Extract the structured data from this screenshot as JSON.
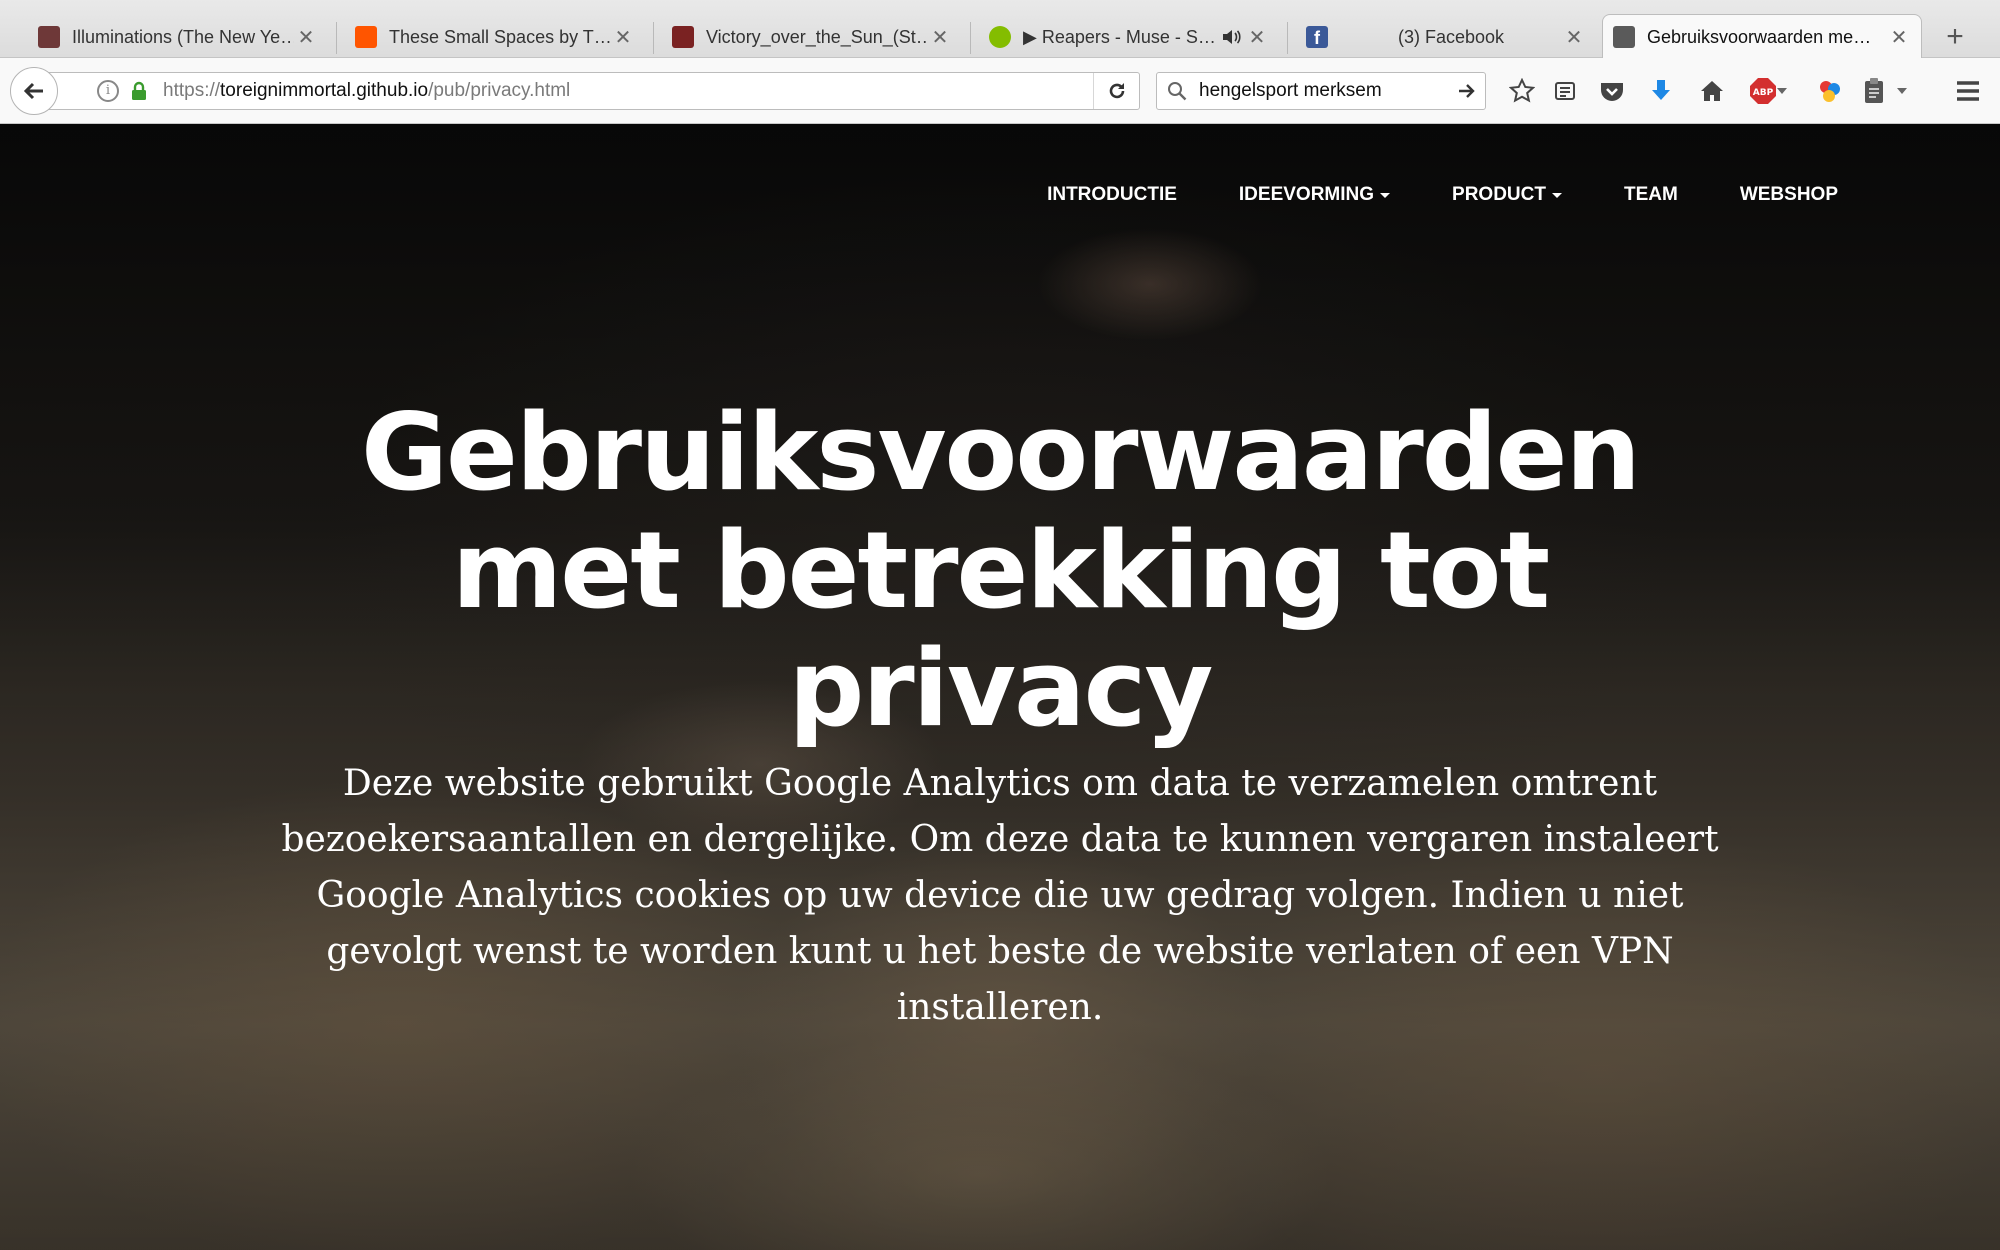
{
  "browser": {
    "tabs": [
      {
        "label": "Illuminations (The New Ye…",
        "favicon_color": "#7a3b3b",
        "active": false
      },
      {
        "label": "These Small Spaces by T…",
        "favicon_color": "#ff5500",
        "active": false
      },
      {
        "label": "Victory_over_the_Sun_(St…",
        "favicon_color": "#8a2a2a",
        "active": false
      },
      {
        "label": "▶ Reapers - Muse - S…",
        "favicon_color": "#84bd00",
        "active": false
      },
      {
        "label": "(3) Facebook",
        "favicon_color": "#3b5998",
        "active": false
      },
      {
        "label": "Gebruiksvoorwaarden me…",
        "favicon_color": "#555555",
        "active": true
      }
    ],
    "new_tab_label": "+",
    "close_glyph": "✕",
    "url": {
      "scheme": "https://",
      "domain": "toreignimmortal.github.io",
      "path": "/pub/privacy.html"
    },
    "search_value": "hengelsport merksem",
    "toolbar_icons": [
      "star-icon",
      "reader-list-icon",
      "pocket-icon",
      "download-icon",
      "home-icon",
      "adblock-plus-icon",
      "color-extension-icon",
      "clipboard-icon",
      "menu-icon"
    ],
    "adblock_label": "ABP"
  },
  "site": {
    "nav": [
      {
        "label": "INTRODUCTIE",
        "dropdown": false
      },
      {
        "label": "IDEEVORMING",
        "dropdown": true
      },
      {
        "label": "PRODUCT",
        "dropdown": true
      },
      {
        "label": "TEAM",
        "dropdown": false
      },
      {
        "label": "WEBSHOP",
        "dropdown": false
      }
    ],
    "hero": {
      "title": "Gebruiksvoorwaarden met betrekking tot privacy",
      "body": "Deze website gebruikt Google Analytics om data te verzamelen omtrent bezoekersaantallen en dergelijke. Om deze data te kunnen vergaren instaleert Google Analytics cookies op uw device die uw gedrag volgen. Indien u niet gevolgt wenst te worden kunt u het beste de website verlaten of een VPN installeren."
    }
  }
}
